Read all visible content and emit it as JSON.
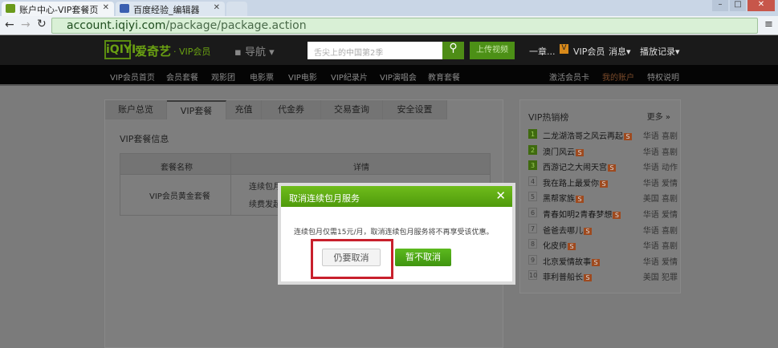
{
  "browser": {
    "tabs": [
      {
        "title": "账户中心-VIP套餐页"
      },
      {
        "title": "百度经验_编辑器"
      }
    ],
    "url_domain": "account.iqiyi.com",
    "url_path": "/package/package.action"
  },
  "header": {
    "logo": "iQIYI",
    "brand": "爱奇艺",
    "brand_sub": "· VIP会员",
    "nav_label": "导航",
    "search_placeholder": "舌尖上的中国第2季",
    "upload": "上传视频",
    "user": "一章...",
    "vip": "VIP会员",
    "messages": "消息",
    "history": "播放记录"
  },
  "subnav": {
    "left": [
      "VIP会员首页",
      "会员套餐",
      "观影团",
      "电影票",
      "VIP电影",
      "VIP纪录片",
      "VIP演唱会",
      "教育套餐"
    ],
    "right": [
      "激活会员卡",
      "我的账户",
      "特权说明"
    ]
  },
  "account": {
    "tabs": [
      "账户总览",
      "VIP套餐",
      "充值",
      "代金券",
      "交易查询",
      "安全设置"
    ],
    "section_title": "VIP套餐信息",
    "col_name": "套餐名称",
    "col_detail": "详情",
    "row_name": "VIP会员黄金套餐",
    "row_detail1": "连续包月",
    "row_detail2": "续费发起"
  },
  "hot": {
    "title": "VIP热销榜",
    "more": "更多",
    "items": [
      {
        "rank": "1",
        "title": "二龙湖浩哥之风云再起",
        "tag": "华语 喜剧"
      },
      {
        "rank": "2",
        "title": "澳门风云",
        "tag": "华语 喜剧"
      },
      {
        "rank": "3",
        "title": "西游记之大闹天宫",
        "tag": "华语 动作"
      },
      {
        "rank": "4",
        "title": "我在路上最爱你",
        "tag": "华语 爱情"
      },
      {
        "rank": "5",
        "title": "黑帮家族",
        "tag": "美国 喜剧"
      },
      {
        "rank": "6",
        "title": "青春如明2青春梦想",
        "tag": "华语 爱情"
      },
      {
        "rank": "7",
        "title": "爸爸去哪儿",
        "tag": "华语 喜剧"
      },
      {
        "rank": "8",
        "title": "化皮师",
        "tag": "华语 喜剧"
      },
      {
        "rank": "9",
        "title": "北京爱情故事",
        "tag": "华语 爱情"
      },
      {
        "rank": "10",
        "title": "菲利普船长",
        "tag": "美国 犯罪"
      }
    ]
  },
  "modal": {
    "title": "取消连续包月服务",
    "message": "连续包月仅需15元/月，取消连续包月服务将不再享受该优惠。",
    "confirm": "仍要取消",
    "cancel": "暂不取消"
  },
  "colors": {
    "green": "#5aa516",
    "highlight": "#c8202c"
  }
}
